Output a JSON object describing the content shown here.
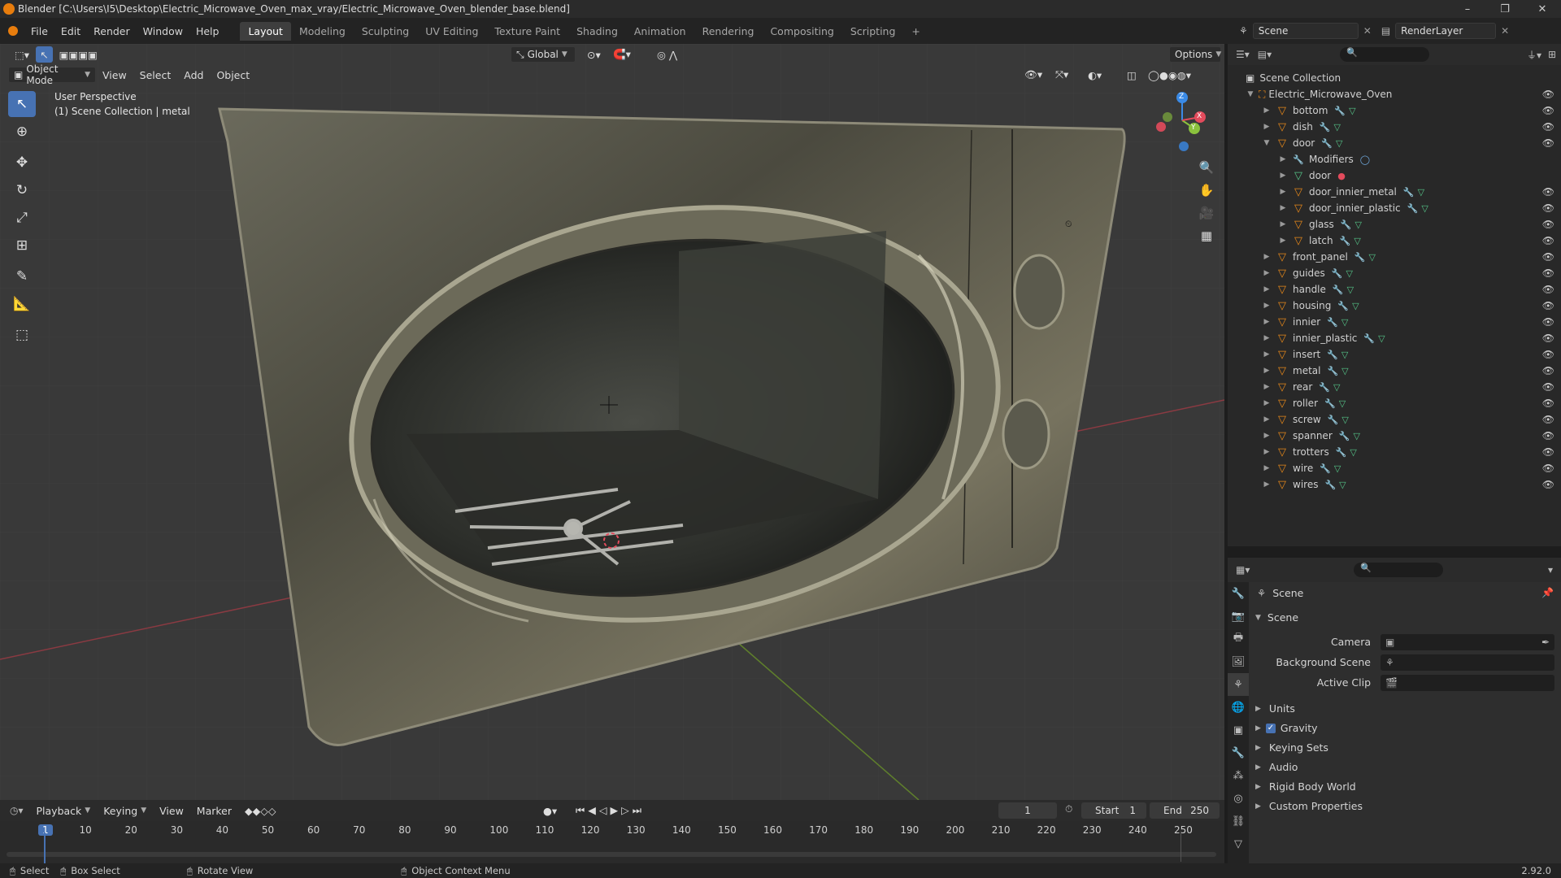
{
  "window": {
    "title": "Blender [C:\\Users\\I5\\Desktop\\Electric_Microwave_Oven_max_vray/Electric_Microwave_Oven_blender_base.blend]",
    "controls": [
      "–",
      "❐",
      "✕"
    ]
  },
  "menu": {
    "items": [
      "File",
      "Edit",
      "Render",
      "Window",
      "Help"
    ],
    "workspaces": [
      "Layout",
      "Modeling",
      "Sculpting",
      "UV Editing",
      "Texture Paint",
      "Shading",
      "Animation",
      "Rendering",
      "Compositing",
      "Scripting"
    ],
    "active_workspace": "Layout",
    "add_tab": "+",
    "scene": "Scene",
    "view_layer": "RenderLayer"
  },
  "viewport": {
    "transform_orientation": "Global",
    "options_label": "Options",
    "mode": "Object Mode",
    "header_menus": [
      "View",
      "Select",
      "Add",
      "Object"
    ],
    "perspective": "User Perspective",
    "context": "(1) Scene Collection | metal",
    "gizmo_axes": {
      "x": "X",
      "y": "Y",
      "z": "Z"
    }
  },
  "outliner": {
    "root": "Scene Collection",
    "collection": "Electric_Microwave_Oven",
    "rows": [
      {
        "label": "bottom",
        "depth": 1,
        "expanded": false,
        "kind": "object"
      },
      {
        "label": "dish",
        "depth": 1,
        "expanded": false,
        "kind": "object"
      },
      {
        "label": "door",
        "depth": 1,
        "expanded": true,
        "kind": "object"
      },
      {
        "label": "Modifiers",
        "depth": 2,
        "expanded": false,
        "kind": "modifiers"
      },
      {
        "label": "door",
        "depth": 2,
        "expanded": false,
        "kind": "mesh"
      },
      {
        "label": "door_innier_metal",
        "depth": 2,
        "expanded": false,
        "kind": "object"
      },
      {
        "label": "door_innier_plastic",
        "depth": 2,
        "expanded": false,
        "kind": "object"
      },
      {
        "label": "glass",
        "depth": 2,
        "expanded": false,
        "kind": "object"
      },
      {
        "label": "latch",
        "depth": 2,
        "expanded": false,
        "kind": "object"
      },
      {
        "label": "front_panel",
        "depth": 1,
        "expanded": false,
        "kind": "object"
      },
      {
        "label": "guides",
        "depth": 1,
        "expanded": false,
        "kind": "object"
      },
      {
        "label": "handle",
        "depth": 1,
        "expanded": false,
        "kind": "object"
      },
      {
        "label": "housing",
        "depth": 1,
        "expanded": false,
        "kind": "object"
      },
      {
        "label": "innier",
        "depth": 1,
        "expanded": false,
        "kind": "object"
      },
      {
        "label": "innier_plastic",
        "depth": 1,
        "expanded": false,
        "kind": "object"
      },
      {
        "label": "insert",
        "depth": 1,
        "expanded": false,
        "kind": "object"
      },
      {
        "label": "metal",
        "depth": 1,
        "expanded": false,
        "kind": "object"
      },
      {
        "label": "rear",
        "depth": 1,
        "expanded": false,
        "kind": "object"
      },
      {
        "label": "roller",
        "depth": 1,
        "expanded": false,
        "kind": "object"
      },
      {
        "label": "screw",
        "depth": 1,
        "expanded": false,
        "kind": "object"
      },
      {
        "label": "spanner",
        "depth": 1,
        "expanded": false,
        "kind": "object"
      },
      {
        "label": "trotters",
        "depth": 1,
        "expanded": false,
        "kind": "object"
      },
      {
        "label": "wire",
        "depth": 1,
        "expanded": false,
        "kind": "object"
      },
      {
        "label": "wires",
        "depth": 1,
        "expanded": false,
        "kind": "object"
      }
    ]
  },
  "properties": {
    "header": "Scene",
    "panel": "Scene",
    "fields": [
      {
        "label": "Camera",
        "value": ""
      },
      {
        "label": "Background Scene",
        "value": ""
      },
      {
        "label": "Active Clip",
        "value": ""
      }
    ],
    "sections": [
      "Units",
      "Gravity",
      "Keying Sets",
      "Audio",
      "Rigid Body World",
      "Custom Properties"
    ],
    "gravity_checked": true
  },
  "timeline": {
    "menus": [
      "Playback",
      "Keying",
      "View",
      "Marker"
    ],
    "current_frame": "1",
    "start_label": "Start",
    "start": "1",
    "end_label": "End",
    "end": "250",
    "ticks": [
      "1",
      "10",
      "20",
      "30",
      "40",
      "50",
      "60",
      "70",
      "80",
      "90",
      "100",
      "110",
      "120",
      "130",
      "140",
      "150",
      "160",
      "170",
      "180",
      "190",
      "200",
      "210",
      "220",
      "230",
      "240",
      "250"
    ]
  },
  "statusbar": {
    "items": [
      "Select",
      "Box Select",
      "Rotate View",
      "Object Context Menu"
    ],
    "version": "2.92.0"
  },
  "colors": {
    "accent": "#4772b3",
    "object_orange": "#e8891a",
    "mesh_green": "#55c488",
    "axis_x": "#e34b5c",
    "axis_y": "#8ac23d",
    "axis_z": "#3a8ae6"
  }
}
